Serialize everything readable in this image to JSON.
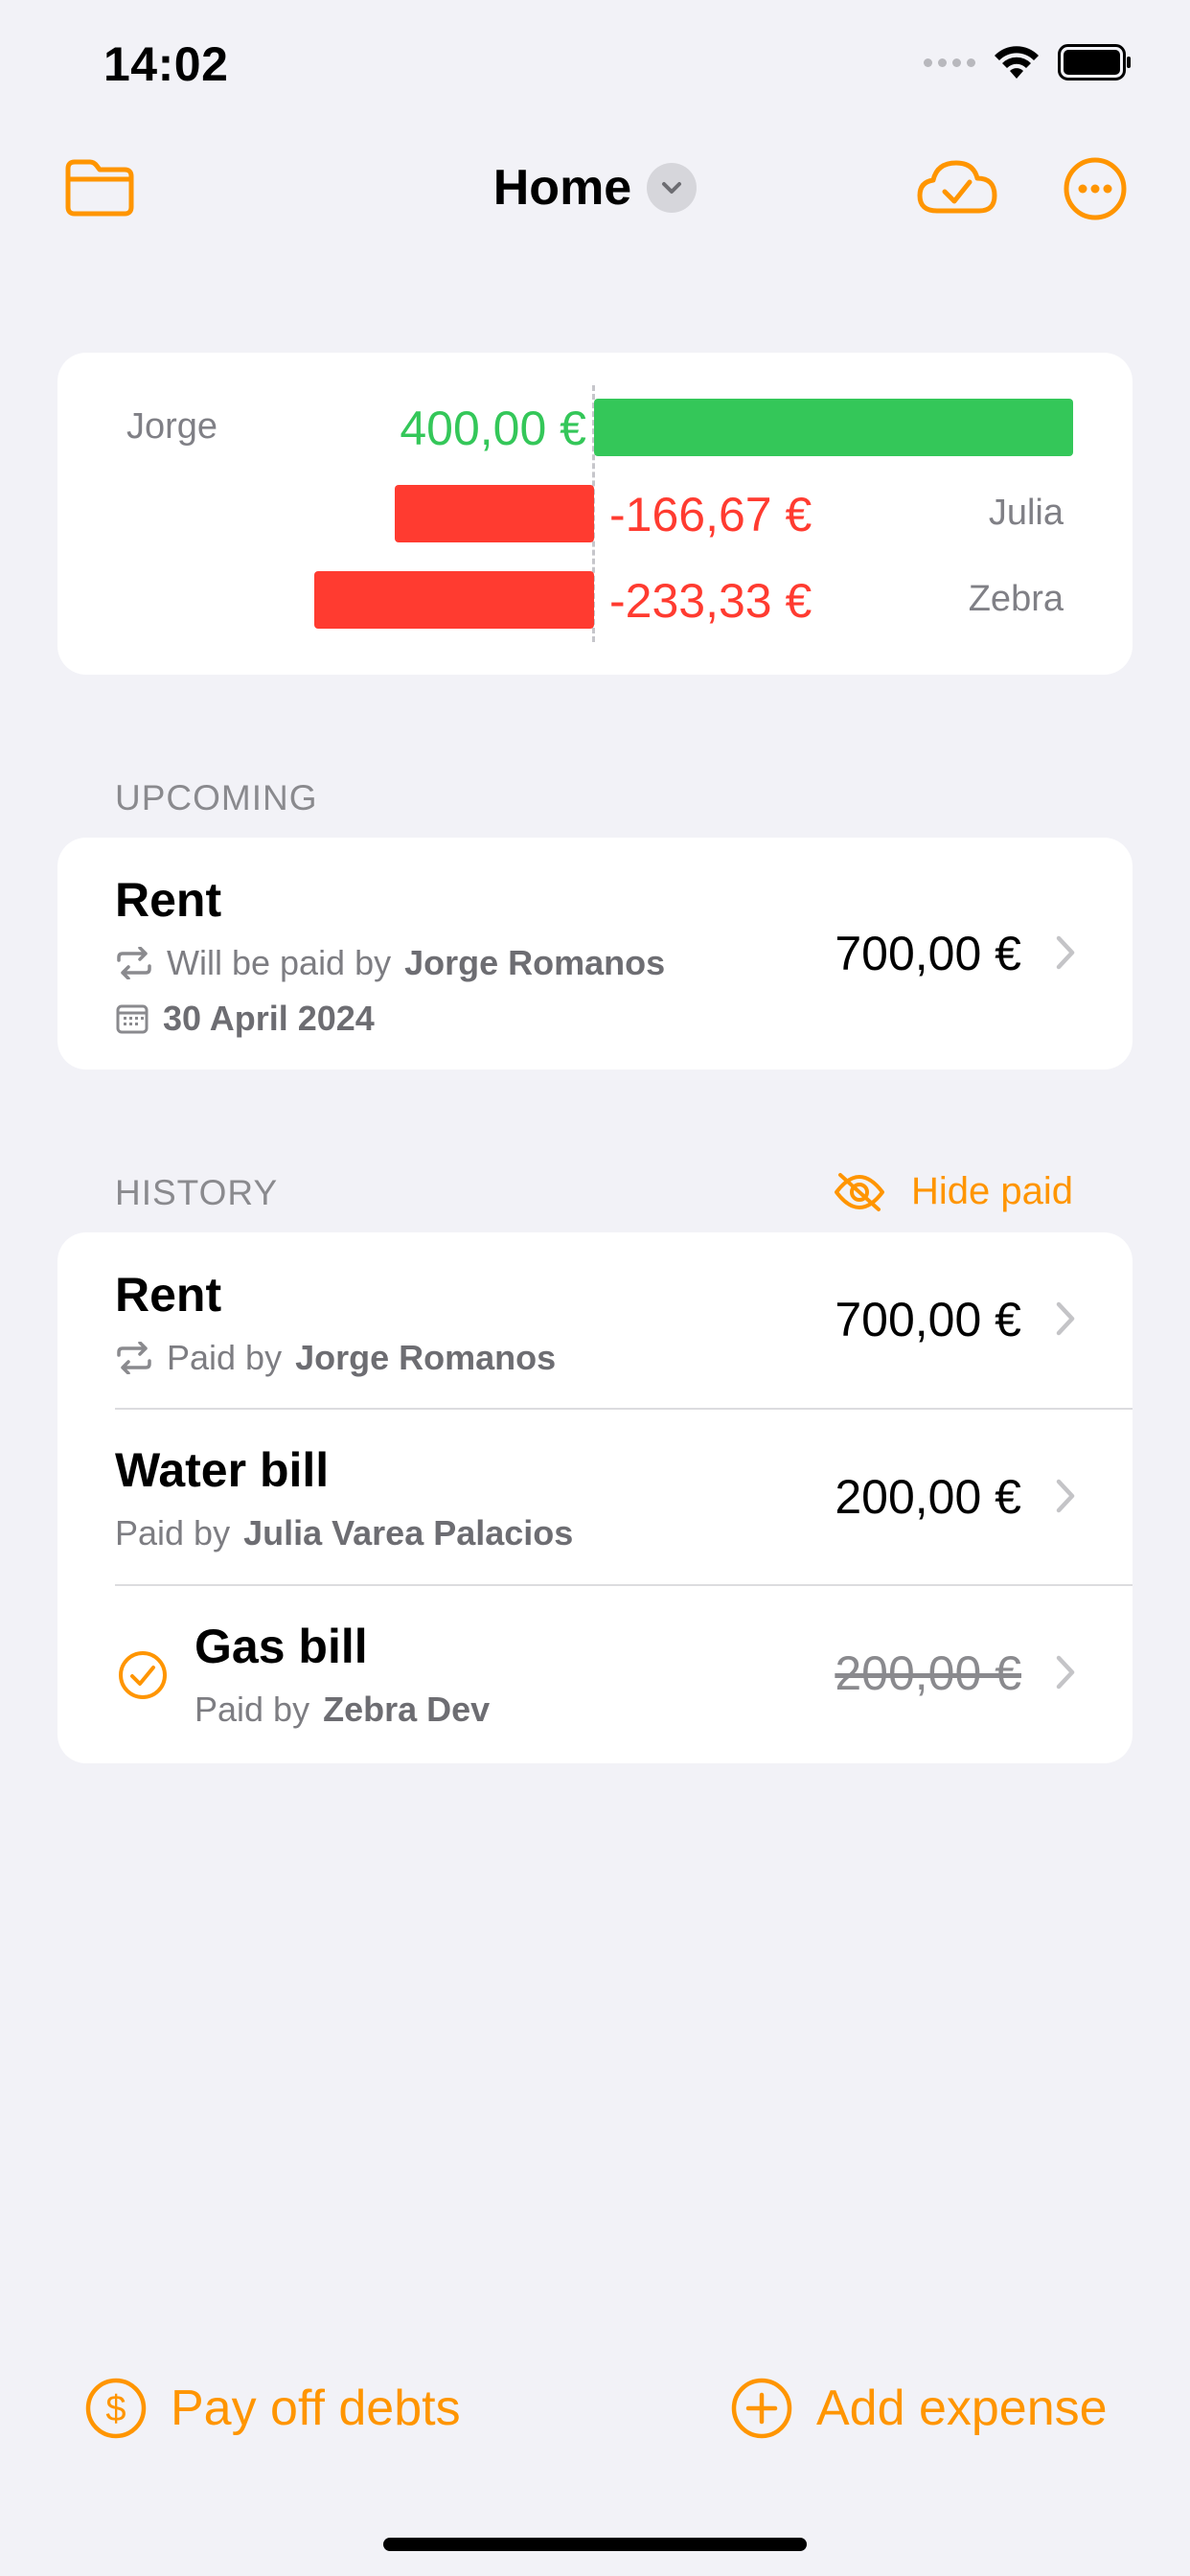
{
  "status_bar": {
    "time": "14:02"
  },
  "nav": {
    "title": "Home",
    "icons": {
      "left": "folder-icon",
      "cloud": "cloud-check-icon",
      "more": "more-icon"
    }
  },
  "balance": [
    {
      "name": "Jorge",
      "amount": "400,00 €",
      "value": 400.0,
      "positive": true
    },
    {
      "name": "Julia",
      "amount": "-166,67 €",
      "value": -166.67,
      "positive": false
    },
    {
      "name": "Zebra",
      "amount": "-233,33 €",
      "value": -233.33,
      "positive": false
    }
  ],
  "upcoming": {
    "header": "UPCOMING",
    "item": {
      "title": "Rent",
      "sub_prefix": "Will be paid by",
      "payer": "Jorge Romanos",
      "date": "30 April 2024",
      "amount": "700,00 €"
    }
  },
  "history": {
    "header": "HISTORY",
    "hide_paid_label": "Hide paid",
    "items": [
      {
        "title": "Rent",
        "sub_prefix": "Paid by",
        "payer": "Jorge Romanos",
        "amount": "700,00 €"
      },
      {
        "title": "Water bill",
        "sub_prefix": "Paid by",
        "payer": "Julia Varea Palacios",
        "amount": "200,00 €"
      },
      {
        "title": "Gas bill",
        "sub_prefix": "Paid by",
        "payer": "Zebra Dev",
        "amount": "200,00 €"
      }
    ]
  },
  "bottom": {
    "pay_off_label": "Pay off debts",
    "add_expense_label": "Add expense"
  },
  "colors": {
    "accent": "#ff9500",
    "positive": "#34c759",
    "negative": "#ff3b30",
    "background": "#f2f2f7"
  }
}
